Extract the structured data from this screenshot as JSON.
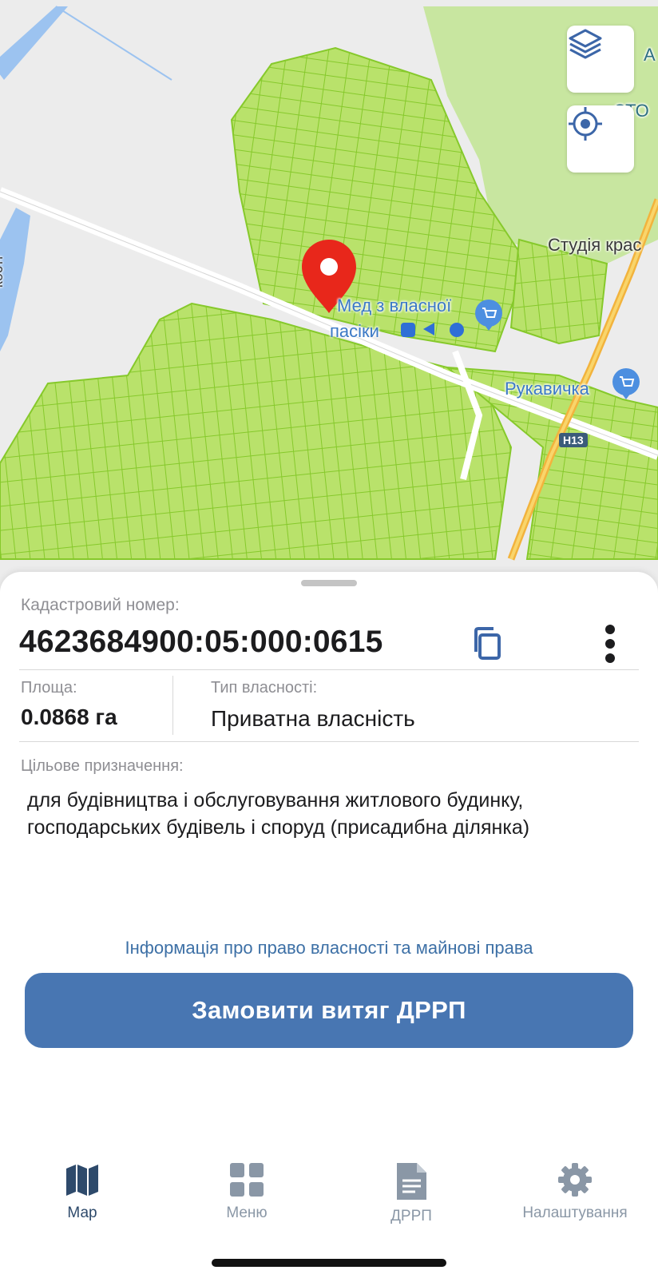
{
  "map": {
    "labels": {
      "sto": "СТО",
      "letter_a": "А",
      "studio": "Студія крас",
      "honey": [
        "Мед з власної",
        "пасіки"
      ],
      "store": "Рукавичка",
      "road": "Н13",
      "street": "кості"
    },
    "icons": [
      "layers-icon",
      "locate-icon",
      "location-pin-icon",
      "shopping-cart-icon"
    ]
  },
  "parcel": {
    "cadastral_label": "Кадастровий номер:",
    "cadastral_number": "4623684900:05:000:0615",
    "area_label": "Площа:",
    "area_value": "0.0868 га",
    "ownership_label": "Тип власності:",
    "ownership_value": "Приватна власність",
    "purpose_label": "Цільове призначення:",
    "purpose_line1": "для будівництва і обслуговування житлового будинку,",
    "purpose_line2": "господарських будівель і споруд (присадибна ділянка)",
    "rights_link": "Інформація про право власності та майнові права",
    "order_button": "Замовити витяг ДРРП"
  },
  "tabs": [
    {
      "label": "Мар",
      "icon": "map-icon",
      "active": true
    },
    {
      "label": "Меню",
      "icon": "grid-icon",
      "active": false
    },
    {
      "label": "ДРРП",
      "icon": "document-icon",
      "active": false
    },
    {
      "label": "Налаштування",
      "icon": "gear-icon",
      "active": false
    }
  ],
  "colors": {
    "accent": "#4876b2",
    "parcel_fill": "#b9e26b",
    "parcel_stroke": "#86c92b",
    "pin": "#e8271b"
  }
}
